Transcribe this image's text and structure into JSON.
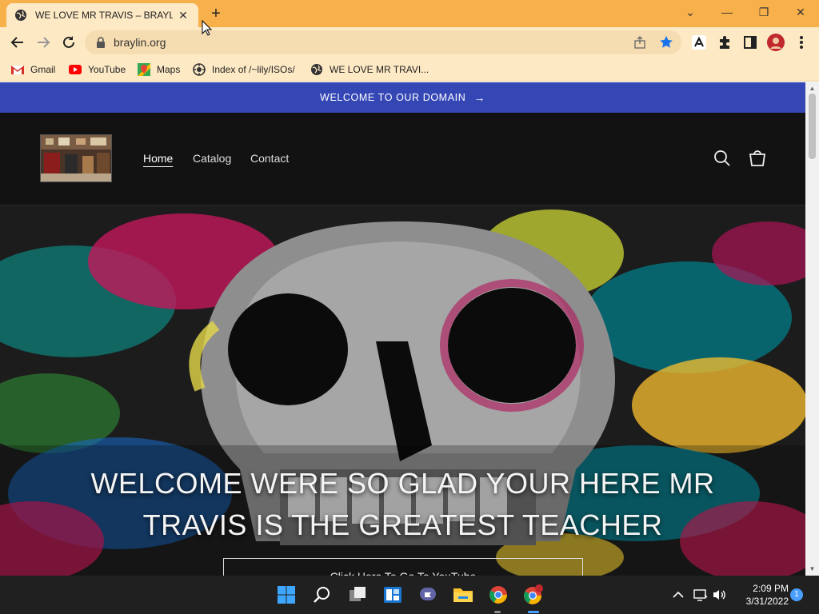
{
  "browser": {
    "tab": {
      "title": "WE LOVE MR TRAVIS – BRAYLIN.O",
      "favicon": "globe-icon"
    },
    "new_tab_label": "+",
    "window_controls": {
      "dropdown": "⌄",
      "minimize": "—",
      "restore": "❐",
      "close": "✕"
    },
    "url": "braylin.org",
    "bookmarks": [
      {
        "label": "Gmail",
        "icon": "gmail-icon"
      },
      {
        "label": "YouTube",
        "icon": "youtube-icon"
      },
      {
        "label": "Maps",
        "icon": "maps-icon"
      },
      {
        "label": "Index of /~lily/ISOs/",
        "icon": "index-icon"
      },
      {
        "label": "WE LOVE MR TRAVI...",
        "icon": "globe-icon"
      }
    ],
    "colors": {
      "frame": "#f7b04a",
      "toolbar": "#fde9c4",
      "star": "#1a73e8"
    }
  },
  "page": {
    "announcement": {
      "text": "WELCOME TO OUR DOMAIN",
      "arrow": "→"
    },
    "nav": [
      "Home",
      "Catalog",
      "Contact"
    ],
    "active_nav": "Home",
    "hero": {
      "title": "WELCOME WERE SO GLAD YOUR HERE MR TRAVIS IS THE GREATEST TEACHER",
      "button_label": "Click Here To Go To YouTube"
    },
    "colors": {
      "announcement_bg": "#3447b5",
      "header_bg": "#121212"
    }
  },
  "taskbar": {
    "time": "2:09 PM",
    "date": "3/31/2022",
    "notification_count": "1",
    "apps": [
      "windows-start-icon",
      "search-icon",
      "task-view-icon",
      "widgets-icon",
      "teams-chat-icon",
      "file-explorer-icon",
      "chrome-icon",
      "chrome-profile-icon"
    ]
  }
}
